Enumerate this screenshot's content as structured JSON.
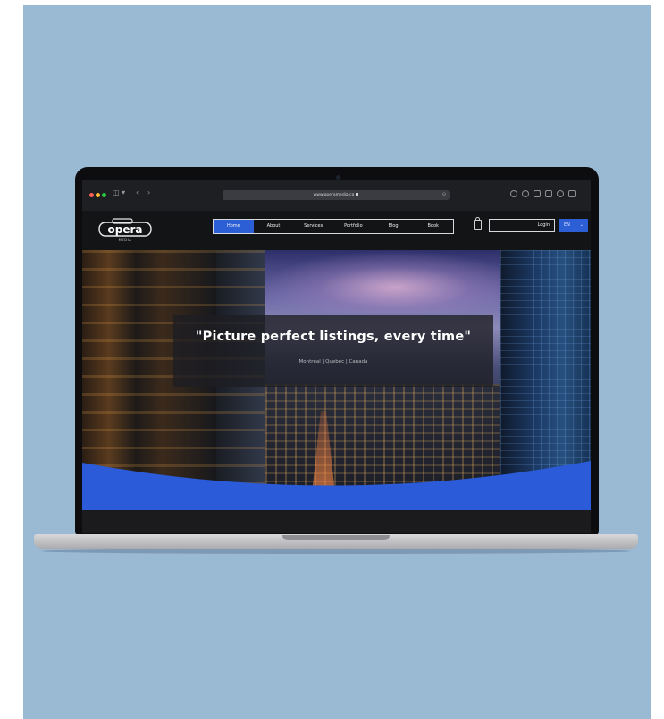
{
  "browser": {
    "url": "www.operamedia.ca",
    "traffic_lights": {
      "red": "#ff5f57",
      "yellow": "#febc2e",
      "green": "#28c840"
    }
  },
  "site": {
    "logo": {
      "word": "opera",
      "sub": "MEDIA"
    },
    "nav": [
      {
        "label": "Home",
        "active": true
      },
      {
        "label": "About",
        "active": false
      },
      {
        "label": "Services",
        "active": false
      },
      {
        "label": "Portfolio",
        "active": false
      },
      {
        "label": "Blog",
        "active": false
      },
      {
        "label": "Book",
        "active": false
      }
    ],
    "login_label": "Login",
    "language": "EN",
    "accent_color": "#2c5fd6"
  },
  "hero": {
    "tagline": "\"Picture perfect listings, every time\"",
    "location": "Montreal | Quebec | Canada",
    "wave_color": "#2b5bd8"
  },
  "background_color": "#9ab9d2"
}
